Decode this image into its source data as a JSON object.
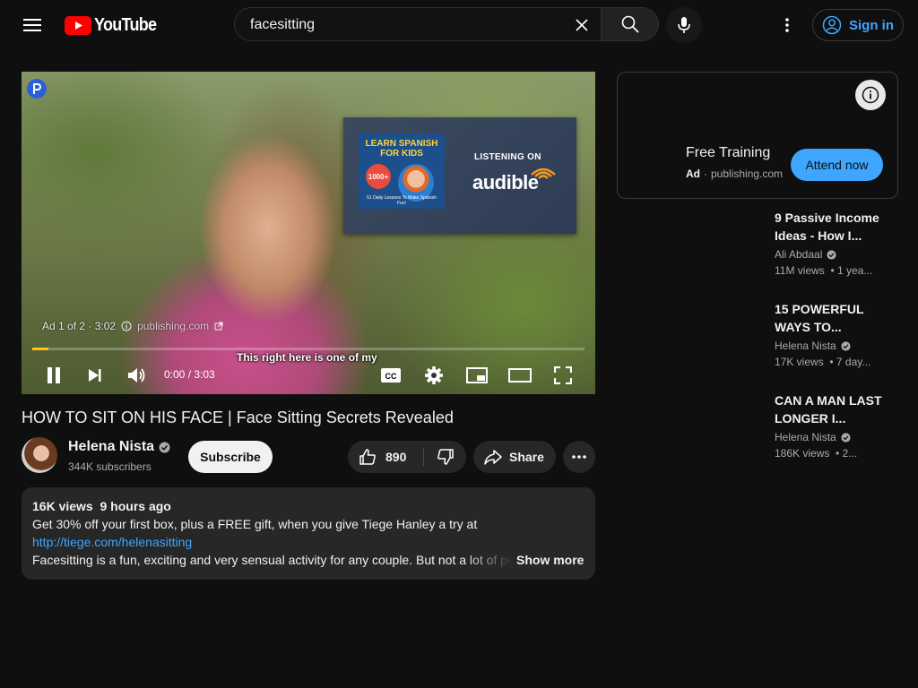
{
  "header": {
    "logo_text": "YouTube",
    "search_query": "facesitting",
    "signin_label": "Sign in"
  },
  "player": {
    "ad_info": "Ad 1 of 2 · 3:02",
    "ad_domain": "publishing.com",
    "promo": {
      "book_title": "LEARN SPANISH FOR KIDS",
      "book_badge": "1000+",
      "book_subtitle": "51 Daily Lessons To Make Spanish Fun!",
      "listening_on": "LISTENING ON",
      "brand": "audible"
    },
    "subtitle": "This right here is one of my",
    "time": "0:00 / 3:03",
    "progress": 0.03,
    "progress_color": "#ffc21a"
  },
  "video": {
    "title": "HOW TO SIT ON HIS FACE | Face Sitting Secrets Revealed",
    "channel": "Helena Nista",
    "subscribers": "344K subscribers",
    "subscribe_label": "Subscribe",
    "likes": "890",
    "share_label": "Share"
  },
  "description": {
    "meta": "16K views  9 hours ago",
    "line1": "Get 30% off your first box, plus a FREE gift, when you give Tiege Hanley a try at",
    "link": "http://tiege.com/helenasitting",
    "line3": "Facesitting is a fun, exciting and very sensual activity for any couple. But not a lot of people",
    "show_more": "Show more"
  },
  "ad_card": {
    "title": "Free Training",
    "label": "Ad",
    "domain": "publishing.com",
    "cta": "Attend now"
  },
  "recommendations": [
    {
      "title": "9 Passive Income Ideas - How I...",
      "channel": "Ali Abdaal",
      "meta": "11M views  • 1 yea..."
    },
    {
      "title": "15 POWERFUL WAYS TO...",
      "channel": "Helena Nista",
      "meta": "17K views  • 7 day..."
    },
    {
      "title": "CAN A MAN LAST LONGER I...",
      "channel": "Helena Nista",
      "meta": "186K views  • 2..."
    }
  ],
  "colors": {
    "background": "#0f0f0f",
    "brand_red": "#ff0000",
    "link_blue": "#3ea6ff"
  }
}
